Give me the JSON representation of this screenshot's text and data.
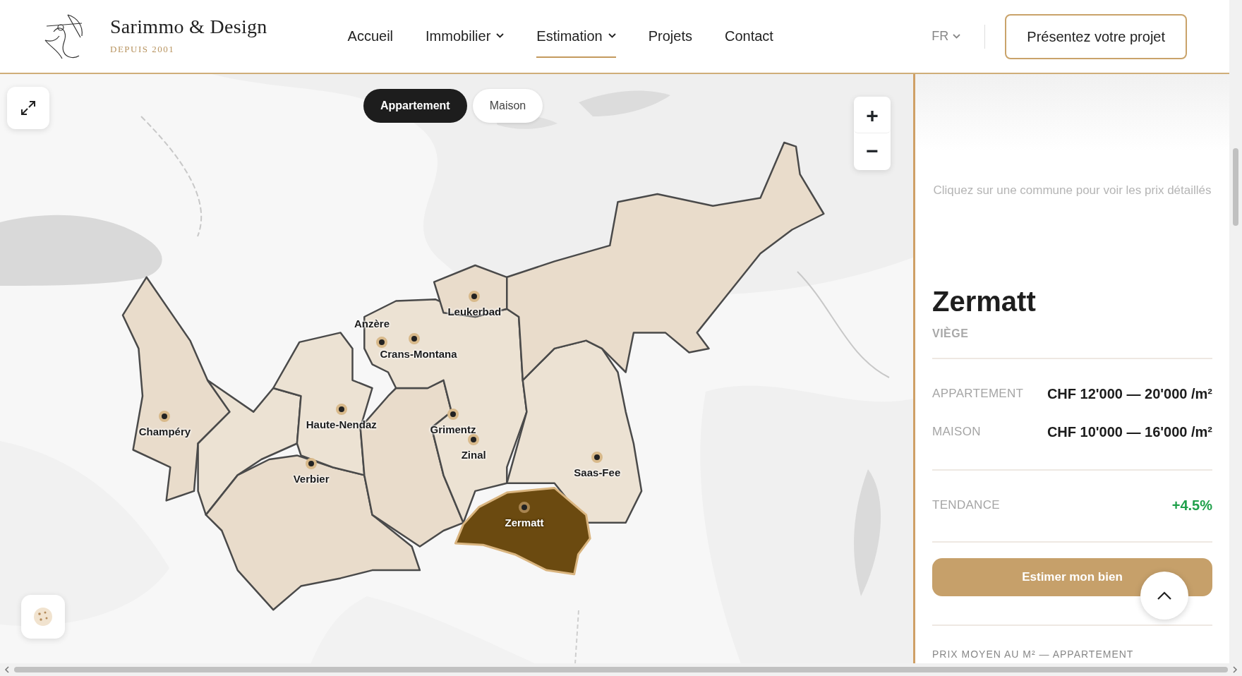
{
  "brand": {
    "name": "Sarimmo & Design",
    "tagline": "DEPUIS 2001"
  },
  "nav": [
    {
      "label": "Accueil",
      "has_menu": false,
      "selected": false
    },
    {
      "label": "Immobilier",
      "has_menu": true,
      "selected": false
    },
    {
      "label": "Estimation",
      "has_menu": true,
      "selected": true
    },
    {
      "label": "Projets",
      "has_menu": false,
      "selected": false
    },
    {
      "label": "Contact",
      "has_menu": false,
      "selected": false
    }
  ],
  "language": {
    "label": "FR"
  },
  "cta_button": "Présentez votre projet",
  "map": {
    "type_toggle": [
      {
        "label": "Appartement",
        "selected": true
      },
      {
        "label": "Maison",
        "selected": false
      }
    ],
    "zoom_in": "+",
    "zoom_out": "−",
    "communes": [
      {
        "name": "Leukerbad",
        "selected": false
      },
      {
        "name": "Anzère",
        "selected": false
      },
      {
        "name": "Crans-Montana",
        "selected": false
      },
      {
        "name": "Champéry",
        "selected": false
      },
      {
        "name": "Haute-Nendaz",
        "selected": false
      },
      {
        "name": "Grimentz",
        "selected": false
      },
      {
        "name": "Zinal",
        "selected": false
      },
      {
        "name": "Verbier",
        "selected": false
      },
      {
        "name": "Saas-Fee",
        "selected": false
      },
      {
        "name": "Zermatt",
        "selected": true
      }
    ]
  },
  "panel": {
    "hint": "Cliquez sur une commune pour voir les prix détaillés",
    "title": "Zermatt",
    "district": "VIÈGE",
    "prices": [
      {
        "label": "APPARTEMENT",
        "value": "CHF 12'000 — 20'000 /m²"
      },
      {
        "label": "MAISON",
        "value": "CHF 10'000 — 16'000 /m²"
      }
    ],
    "trend": {
      "label": "TENDANCE",
      "value": "+4.5%"
    },
    "button": "Estimer mon bien",
    "section_title": "PRIX MOYEN AU M² — APPARTEMENT"
  }
}
